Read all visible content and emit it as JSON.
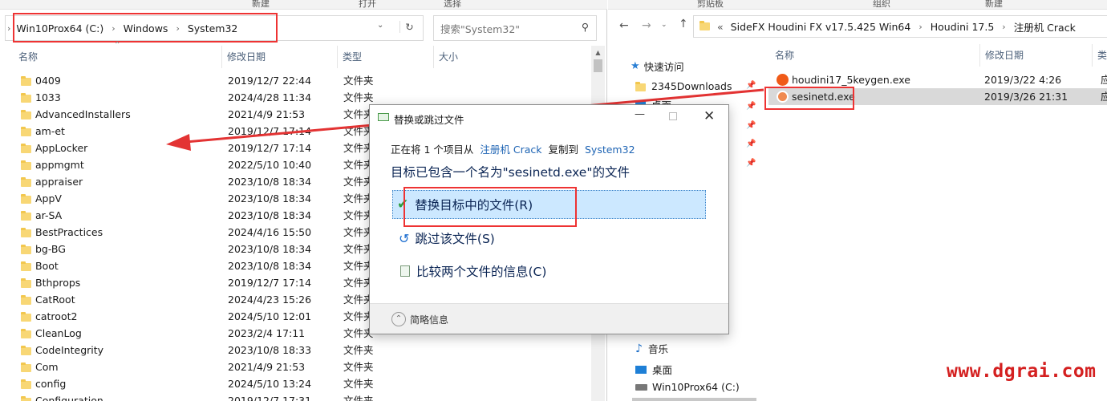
{
  "left_window": {
    "top_toolbar": [
      "新建",
      "打开",
      "选择"
    ],
    "breadcrumb": [
      "Win10Prox64 (C:)",
      "Windows",
      "System32"
    ],
    "search_placeholder": "搜索\"System32\"",
    "columns": [
      "名称",
      "修改日期",
      "类型",
      "大小"
    ],
    "files": [
      {
        "name": "0409",
        "date": "2019/12/7 22:44",
        "type": "文件夹"
      },
      {
        "name": "1033",
        "date": "2024/4/28 11:34",
        "type": "文件夹"
      },
      {
        "name": "AdvancedInstallers",
        "date": "2021/4/9 21:53",
        "type": "文件夹"
      },
      {
        "name": "am-et",
        "date": "2019/12/7 17:14",
        "type": "文件夹"
      },
      {
        "name": "AppLocker",
        "date": "2019/12/7 17:14",
        "type": "文件夹"
      },
      {
        "name": "appmgmt",
        "date": "2022/5/10 10:40",
        "type": "文件夹"
      },
      {
        "name": "appraiser",
        "date": "2023/10/8 18:34",
        "type": "文件夹"
      },
      {
        "name": "AppV",
        "date": "2023/10/8 18:34",
        "type": "文件夹"
      },
      {
        "name": "ar-SA",
        "date": "2023/10/8 18:34",
        "type": "文件夹"
      },
      {
        "name": "BestPractices",
        "date": "2024/4/16 15:50",
        "type": "文件夹"
      },
      {
        "name": "bg-BG",
        "date": "2023/10/8 18:34",
        "type": "文件夹"
      },
      {
        "name": "Boot",
        "date": "2023/10/8 18:34",
        "type": "文件夹"
      },
      {
        "name": "Bthprops",
        "date": "2019/12/7 17:14",
        "type": "文件夹"
      },
      {
        "name": "CatRoot",
        "date": "2024/4/23 15:26",
        "type": "文件夹"
      },
      {
        "name": "catroot2",
        "date": "2024/5/10 12:01",
        "type": "文件夹"
      },
      {
        "name": "CleanLog",
        "date": "2023/2/4 17:11",
        "type": "文件夹"
      },
      {
        "name": "CodeIntegrity",
        "date": "2023/10/8 18:33",
        "type": "文件夹"
      },
      {
        "name": "Com",
        "date": "2021/4/9 21:53",
        "type": "文件夹"
      },
      {
        "name": "config",
        "date": "2024/5/10 13:24",
        "type": "文件夹"
      },
      {
        "name": "Configuration",
        "date": "2019/12/7 17:31",
        "type": "文件夹"
      }
    ]
  },
  "right_window": {
    "top_toolbar": [
      "剪贴板",
      "组织",
      "新建"
    ],
    "breadcrumb": [
      "SideFX Houdini FX v17.5.425 Win64",
      "Houdini 17.5",
      "注册机 Crack"
    ],
    "nav_quick_access": "快速访问",
    "nav_items": [
      "2345Downloads",
      "桌面"
    ],
    "nav_bottom": [
      "音乐",
      "桌面",
      "Win10Prox64 (C:)"
    ],
    "columns": [
      "名称",
      "修改日期",
      "类"
    ],
    "files": [
      {
        "name": "houdini17_5keygen.exe",
        "date": "2019/3/22 4:26",
        "type": "应"
      },
      {
        "name": "sesinetd.exe",
        "date": "2019/3/26 21:31",
        "type": "应"
      }
    ]
  },
  "dialog": {
    "title": "替换或跳过文件",
    "copy_prefix": "正在将 1 个项目从",
    "copy_source": "注册机 Crack",
    "copy_mid": "复制到",
    "copy_dest": "System32",
    "headline": "目标已包含一个名为\"sesinetd.exe\"的文件",
    "options": [
      "替换目标中的文件(R)",
      "跳过该文件(S)",
      "比较两个文件的信息(C)"
    ],
    "details": "简略信息"
  },
  "watermark": "www.dgrai.com",
  "colors": {
    "link": "#1e64b4",
    "annotation": "#e33333",
    "selection": "#cce8ff",
    "watermark": "#d42020"
  }
}
